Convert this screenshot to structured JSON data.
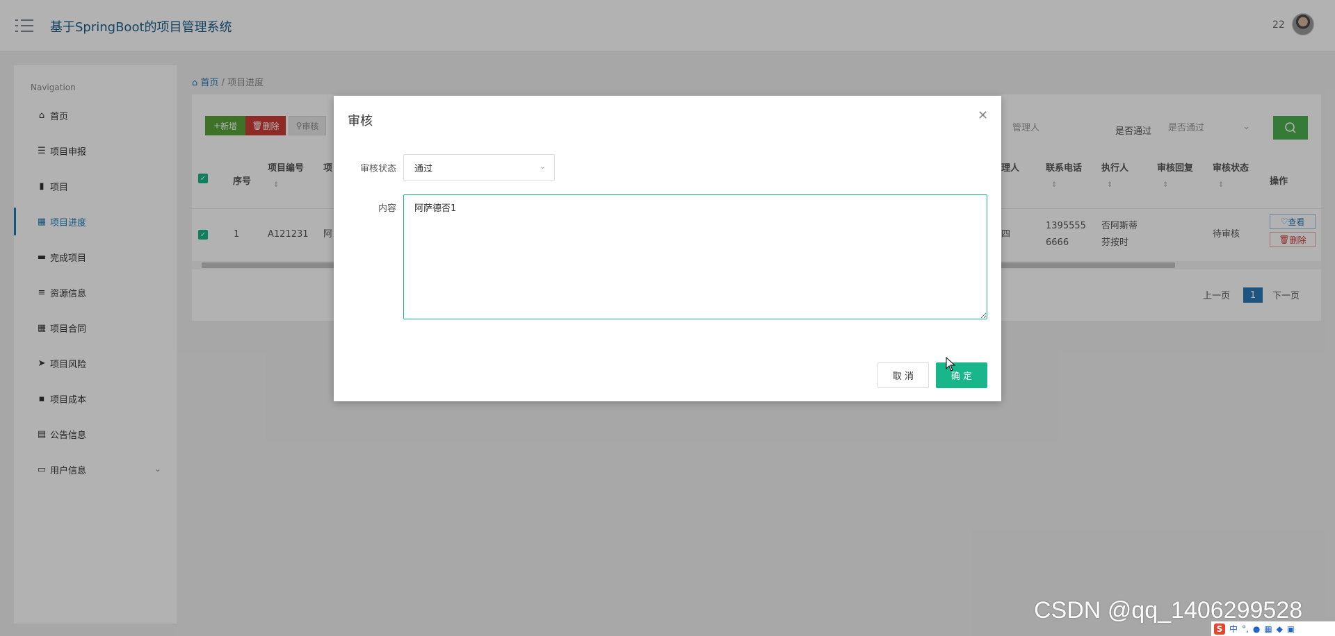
{
  "header": {
    "title": "基于SpringBoot的项目管理系统",
    "user": "22"
  },
  "sidebar": {
    "title": "Navigation",
    "items": [
      {
        "label": "首页",
        "icon": "home-icon"
      },
      {
        "label": "项目申报",
        "icon": "list-icon"
      },
      {
        "label": "项目",
        "icon": "book-icon"
      },
      {
        "label": "项目进度",
        "icon": "grid-icon"
      },
      {
        "label": "完成项目",
        "icon": "monitor-icon"
      },
      {
        "label": "资源信息",
        "icon": "sliders-icon"
      },
      {
        "label": "项目合同",
        "icon": "grid-icon"
      },
      {
        "label": "项目风险",
        "icon": "send-icon"
      },
      {
        "label": "项目成本",
        "icon": "chat-icon"
      },
      {
        "label": "公告信息",
        "icon": "clipboard-icon"
      },
      {
        "label": "用户信息",
        "icon": "card-icon"
      }
    ],
    "active_index": 3
  },
  "breadcrumb": {
    "home": "首页",
    "current": "项目进度"
  },
  "toolbar": {
    "add": "新增",
    "delete": "删除",
    "audit": "审核"
  },
  "filters": {
    "manager_placeholder": "管理人",
    "approved_label": "是否通过",
    "approved_placeholder": "是否通过"
  },
  "table": {
    "headers": {
      "index": "序号",
      "project_no": "项目编号",
      "project_cut": "项",
      "manager_cut": "理人",
      "phone": "联系电话",
      "executor": "执行人",
      "reply": "审核回复",
      "status": "审核状态",
      "actions": "操作"
    },
    "row": {
      "index": "1",
      "project_no": "A121231",
      "project_cut": "阿",
      "manager_cut": "四",
      "phone_l1": "1395555",
      "phone_l2": "6666",
      "executor_l1": "否阿斯蒂",
      "executor_l2": "芬按时",
      "status": "待审核",
      "view": "查看",
      "delete": "删除"
    }
  },
  "pagination": {
    "prev": "上一页",
    "current": "1",
    "next": "下一页"
  },
  "modal": {
    "title": "审核",
    "status_label": "审核状态",
    "status_value": "通过",
    "content_label": "内容",
    "content_value": "阿萨德否1",
    "cancel": "取 消",
    "confirm": "确 定"
  },
  "watermark": "CSDN @qq_1406299528",
  "tray": {
    "ime": "中",
    "punct": "°,"
  },
  "colors": {
    "primary_teal": "#18b68a",
    "link_blue": "#2a7ab8",
    "add_green": "#5aa43c",
    "delete_red": "#cc3b36"
  }
}
